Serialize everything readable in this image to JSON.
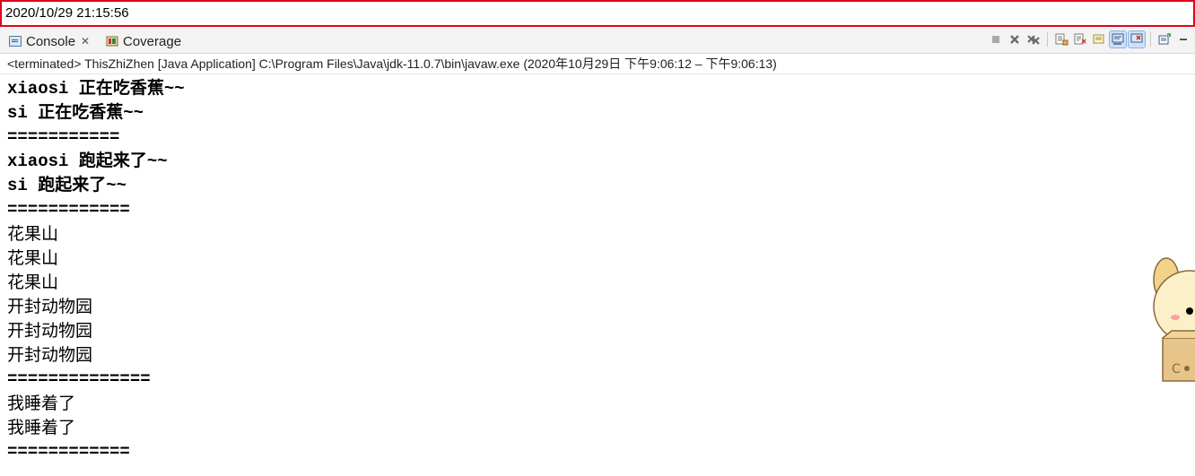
{
  "timestamp": "2020/10/29 21:15:56",
  "tabs": [
    {
      "label": "Console",
      "icon": "console-icon",
      "active": true
    },
    {
      "label": "Coverage",
      "icon": "coverage-icon",
      "active": false
    }
  ],
  "toolbar": {
    "icons": [
      "terminate-icon",
      "remove-launch-icon",
      "remove-all-icon",
      "scroll-lock-icon",
      "word-wrap-icon",
      "show-stdout-icon",
      "pin-console-icon",
      "display-console-icon",
      "open-console-icon",
      "minimize-icon"
    ]
  },
  "status": "<terminated> ThisZhiZhen [Java Application] C:\\Program Files\\Java\\jdk-11.0.7\\bin\\javaw.exe  (2020年10月29日 下午9:06:12 – 下午9:06:13)",
  "output": [
    "xiaosi 正在吃香蕉~~",
    "si 正在吃香蕉~~",
    "===========",
    "xiaosi 跑起来了~~",
    "si 跑起来了~~",
    "============",
    "花果山",
    "花果山",
    "花果山",
    "开封动物园",
    "开封动物园",
    "开封动物园",
    "==============",
    "我睡着了",
    "我睡着了",
    "============"
  ],
  "colors": {
    "timestamp_border": "#e3001b",
    "tabbar_bg": "#f3f3f3"
  }
}
